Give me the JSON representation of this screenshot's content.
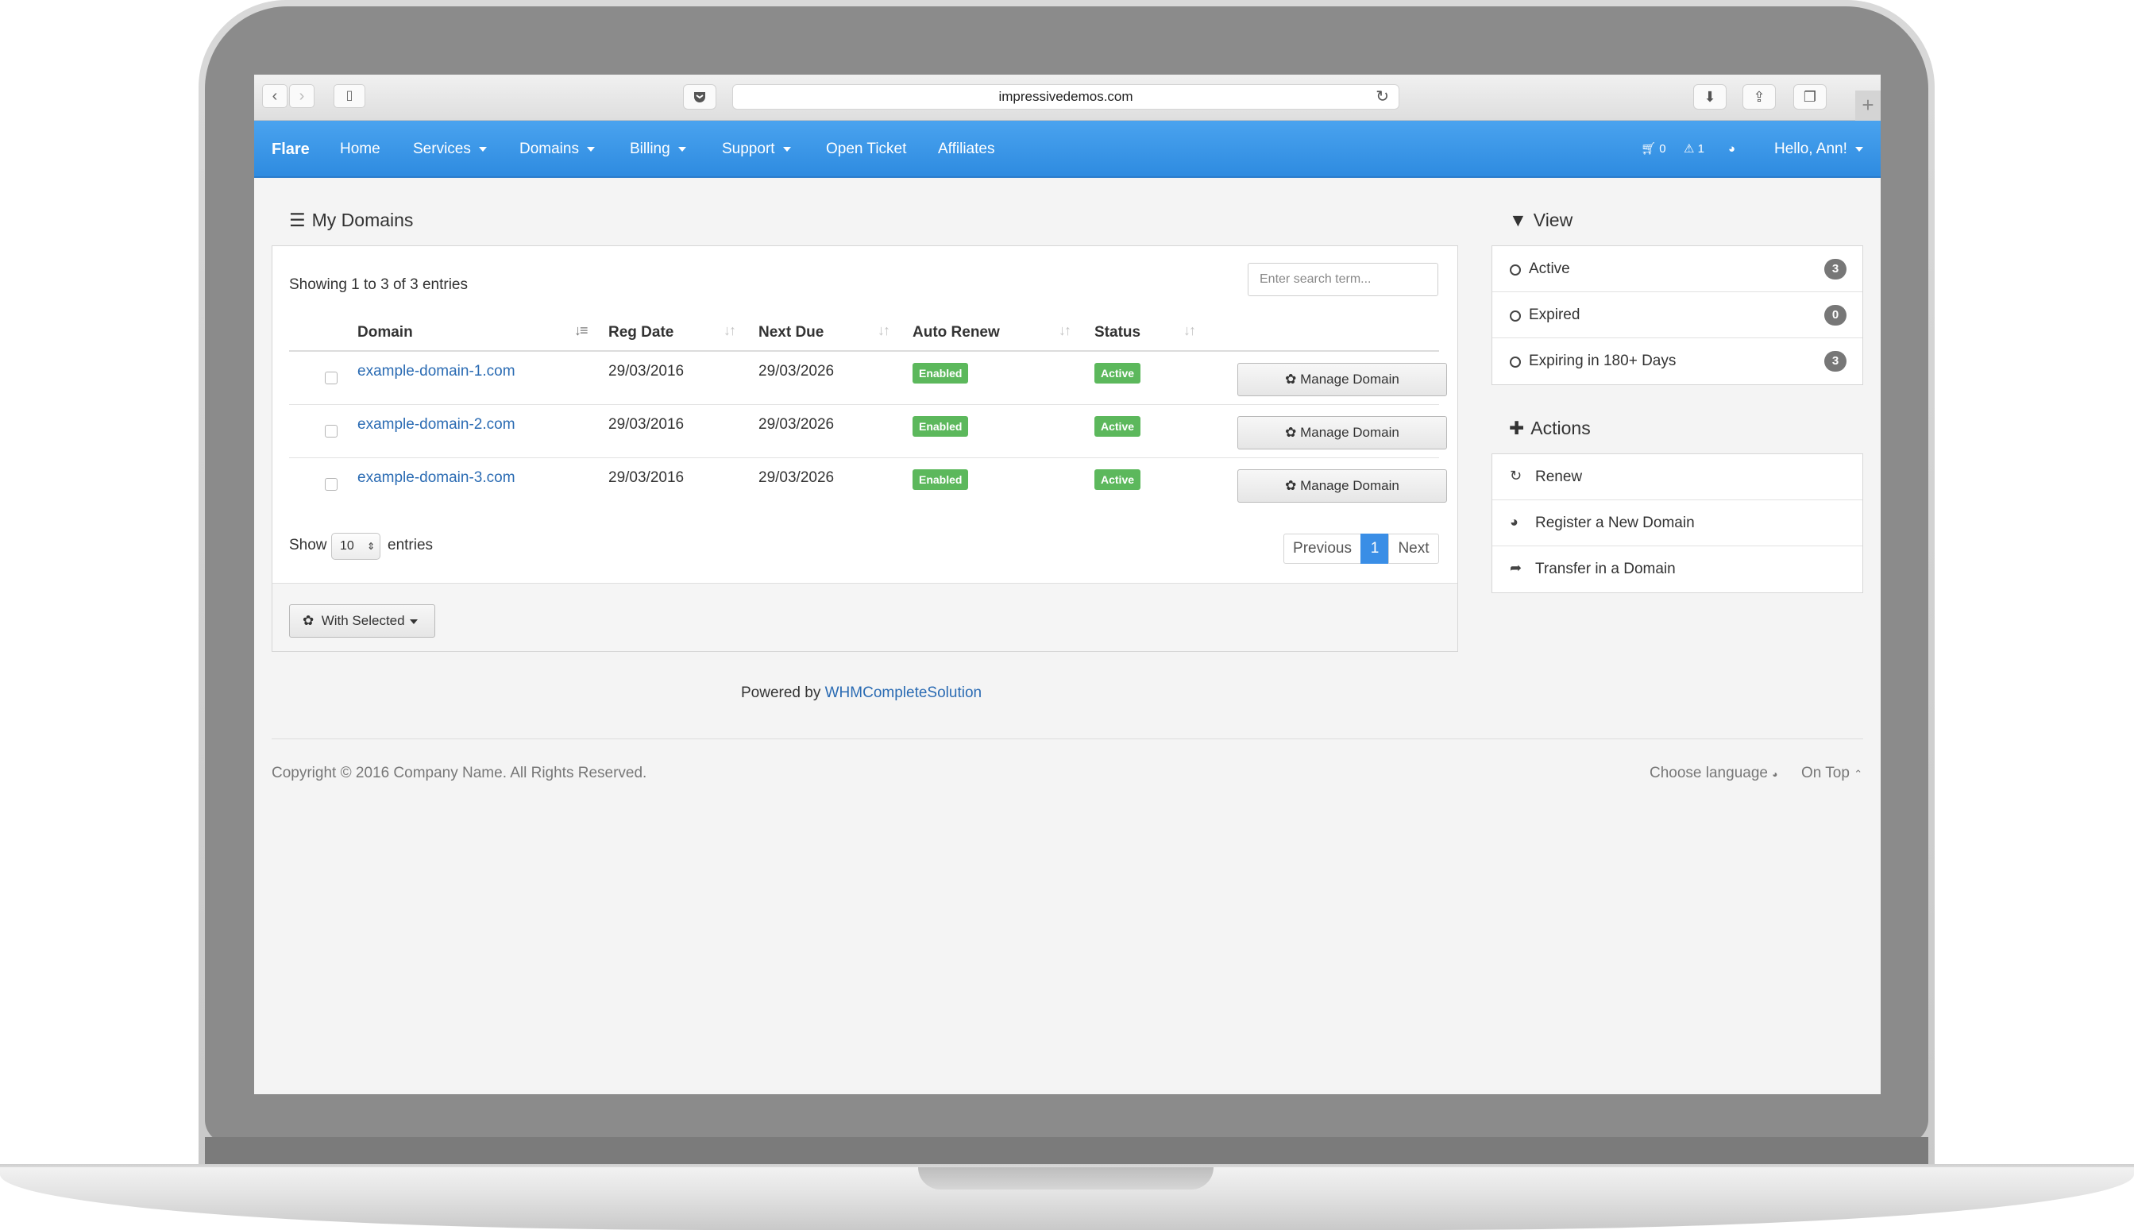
{
  "browser": {
    "url": "impressivedemos.com"
  },
  "navbar": {
    "brand": "Flare",
    "items": [
      {
        "label": "Home",
        "dropdown": false
      },
      {
        "label": "Services",
        "dropdown": true
      },
      {
        "label": "Domains",
        "dropdown": true
      },
      {
        "label": "Billing",
        "dropdown": true
      },
      {
        "label": "Support",
        "dropdown": true
      },
      {
        "label": "Open Ticket",
        "dropdown": false
      },
      {
        "label": "Affiliates",
        "dropdown": false
      }
    ],
    "cart_count": "0",
    "alerts_count": "1",
    "user_greeting": "Hello, Ann!"
  },
  "domains": {
    "title": "My Domains",
    "showing": "Showing 1 to 3 of 3 entries",
    "search_placeholder": "Enter search term...",
    "columns": [
      "Domain",
      "Reg Date",
      "Next Due",
      "Auto Renew",
      "Status"
    ],
    "rows": [
      {
        "domain": "example-domain-1.com",
        "reg_date": "29/03/2016",
        "next_due": "29/03/2026",
        "auto_renew": "Enabled",
        "status": "Active",
        "action": "Manage Domain"
      },
      {
        "domain": "example-domain-2.com",
        "reg_date": "29/03/2016",
        "next_due": "29/03/2026",
        "auto_renew": "Enabled",
        "status": "Active",
        "action": "Manage Domain"
      },
      {
        "domain": "example-domain-3.com",
        "reg_date": "29/03/2016",
        "next_due": "29/03/2026",
        "auto_renew": "Enabled",
        "status": "Active",
        "action": "Manage Domain"
      }
    ],
    "show_label": "Show",
    "page_size": "10",
    "entries_label": "entries",
    "pagination": {
      "previous": "Previous",
      "current": "1",
      "next": "Next"
    },
    "with_selected": "With Selected"
  },
  "powered": {
    "prefix": "Powered by",
    "link": "WHMCompleteSolution"
  },
  "footer": {
    "copyright": "Copyright © 2016 Company Name. All Rights Reserved.",
    "language": "Choose language",
    "on_top": "On Top"
  },
  "sidebar": {
    "view_title": "View",
    "view_items": [
      {
        "label": "Active",
        "count": "3"
      },
      {
        "label": "Expired",
        "count": "0"
      },
      {
        "label": "Expiring in 180+ Days",
        "count": "3"
      }
    ],
    "actions_title": "Actions",
    "action_items": [
      {
        "label": "Renew",
        "icon": "refresh-icon"
      },
      {
        "label": "Register a New Domain",
        "icon": "globe-icon"
      },
      {
        "label": "Transfer in a Domain",
        "icon": "share-icon"
      }
    ]
  },
  "colors": {
    "navbar": "#3593e6",
    "link": "#2a6bb3",
    "success": "#5cb85c",
    "badge": "#777777"
  }
}
